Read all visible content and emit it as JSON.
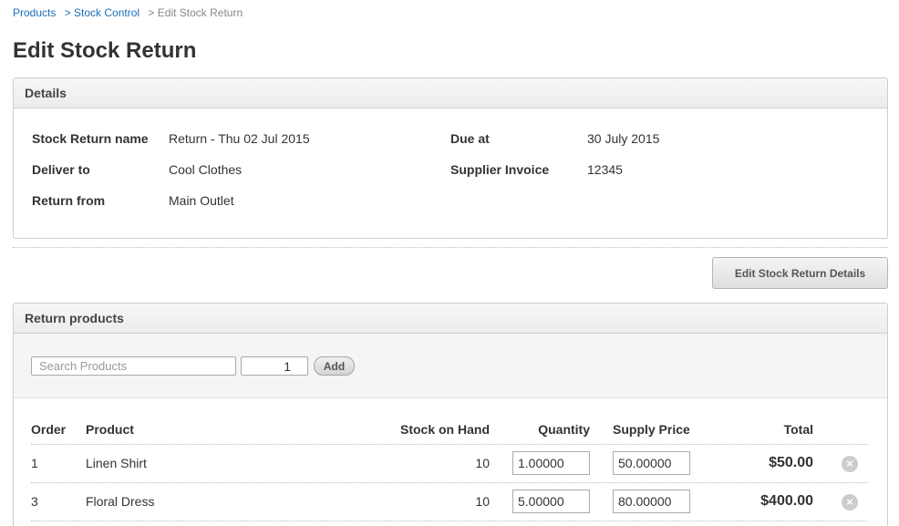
{
  "breadcrumb": {
    "items": [
      {
        "label": "Products"
      },
      {
        "label": "> Stock Control"
      },
      {
        "label": "> Edit Stock Return"
      }
    ]
  },
  "page_title": "Edit Stock Return",
  "details": {
    "header": "Details",
    "fields": {
      "name_label": "Stock Return name",
      "name_value": "Return - Thu 02 Jul 2015",
      "deliver_label": "Deliver to",
      "deliver_value": "Cool Clothes",
      "from_label": "Return from",
      "from_value": "Main Outlet",
      "due_label": "Due at",
      "due_value": "30 July 2015",
      "invoice_label": "Supplier Invoice",
      "invoice_value": "12345"
    }
  },
  "edit_details_button": "Edit Stock Return Details",
  "return_products": {
    "header": "Return products",
    "search_placeholder": "Search Products",
    "qty_value": "1",
    "add_label": "Add",
    "columns": {
      "order": "Order",
      "product": "Product",
      "stock_on_hand": "Stock on Hand",
      "quantity": "Quantity",
      "supply_price": "Supply Price",
      "total": "Total"
    },
    "rows": [
      {
        "order": "1",
        "product": "Linen Shirt",
        "stock_on_hand": "10",
        "quantity": "1.00000",
        "supply_price": "50.00000",
        "total": "$50.00"
      },
      {
        "order": "3",
        "product": "Floral Dress",
        "stock_on_hand": "10",
        "quantity": "5.00000",
        "supply_price": "80.00000",
        "total": "$400.00"
      }
    ],
    "remove_icon": "×"
  },
  "colors": {
    "link": "#1a6fb5",
    "panel_header_bg": "#ececec",
    "remove_icon": "#cccccc"
  }
}
